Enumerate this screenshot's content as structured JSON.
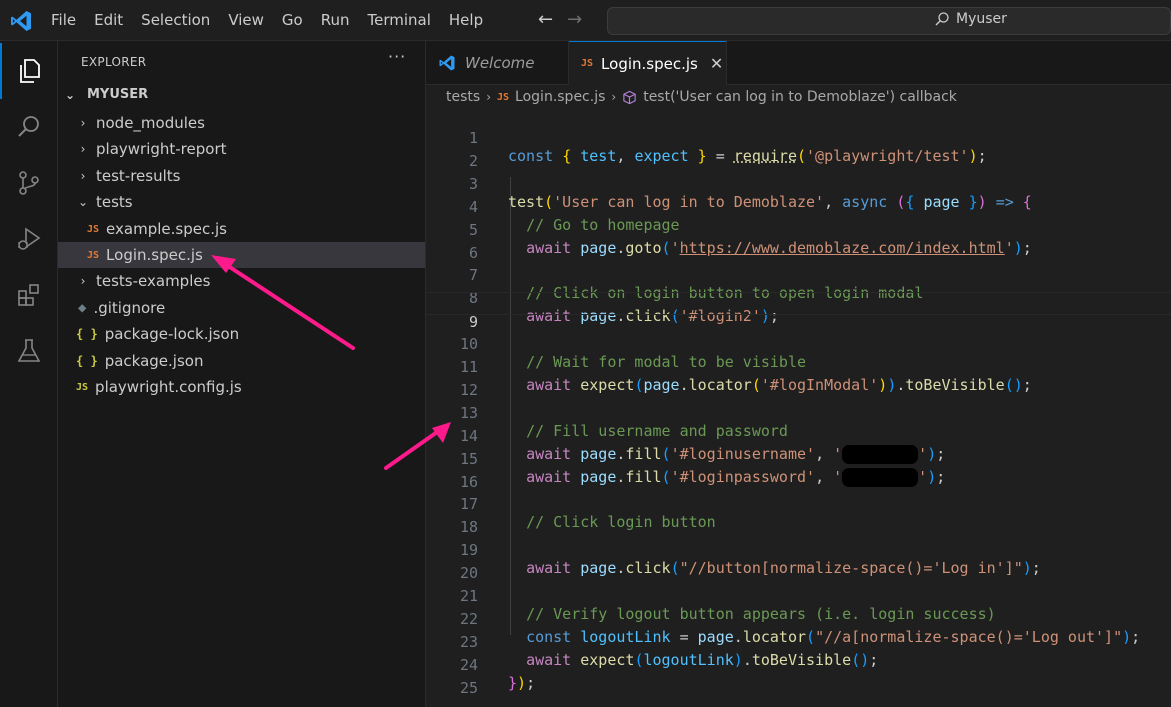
{
  "menu": [
    "File",
    "Edit",
    "Selection",
    "View",
    "Go",
    "Run",
    "Terminal",
    "Help"
  ],
  "search": {
    "text": "Myuser"
  },
  "sidebar": {
    "header": "EXPLORER",
    "root": "MYUSER",
    "items": [
      {
        "label": "node_modules"
      },
      {
        "label": "playwright-report"
      },
      {
        "label": "test-results"
      },
      {
        "label": "tests"
      },
      {
        "label": "example.spec.js",
        "icon": "JS"
      },
      {
        "label": "Login.spec.js",
        "icon": "JS"
      },
      {
        "label": "tests-examples"
      },
      {
        "label": ".gitignore"
      },
      {
        "label": "package-lock.json",
        "icon": "{ }"
      },
      {
        "label": "package.json",
        "icon": "{ }"
      },
      {
        "label": "playwright.config.js",
        "icon": "JS"
      }
    ]
  },
  "tabs": [
    {
      "label": "Welcome"
    },
    {
      "label": "Login.spec.js",
      "icon": "JS"
    }
  ],
  "breadcrumb": {
    "folder": "tests",
    "file": "Login.spec.js",
    "symbol": "test('User can log in to Demoblaze') callback"
  },
  "editor": {
    "line_numbers": [
      "1",
      "2",
      "3",
      "4",
      "5",
      "6",
      "7",
      "8",
      "9",
      "10",
      "11",
      "12",
      "13",
      "14",
      "15",
      "16",
      "17",
      "18",
      "19",
      "20",
      "21",
      "22",
      "23",
      "24",
      "25"
    ],
    "current_line": 9,
    "tokens": {
      "l1_const": "const",
      "l1_test": "test",
      "l1_expect": "expect",
      "l1_require": "require",
      "l1_mod": "'@playwright/test'",
      "l3_test": "test",
      "l3_title": "'User can log in to Demoblaze'",
      "l3_async": "async",
      "l3_page": "page",
      "l4_comment": "// Go to homepage",
      "l5_await": "await",
      "l5_page": "page",
      "l5_goto": "goto",
      "l5_q1": "'",
      "l5_url": "https://www.demoblaze.com/index.html",
      "l5_q2": "'",
      "l7_comment": "// Click on login button to open login modal",
      "l8_await": "await",
      "l8_page": "page",
      "l8_click": "click",
      "l8_sel": "'#login2'",
      "l10_comment": "// Wait for modal to be visible",
      "l11_await": "await",
      "l11_expect": "expect",
      "l11_page": "page",
      "l11_locator": "locator",
      "l11_sel": "'#logInModal'",
      "l11_vis": "toBeVisible",
      "l13_comment": "// Fill username and password",
      "l14_await": "await",
      "l14_page": "page",
      "l14_fill": "fill",
      "l14_sel": "'#loginusername'",
      "l14_q1": "'",
      "l14_q2": "'",
      "l15_await": "await",
      "l15_page": "page",
      "l15_fill": "fill",
      "l15_sel": "'#loginpassword'",
      "l15_q1": "'",
      "l15_q2": "'",
      "l17_comment": "// Click login button",
      "l19_await": "await",
      "l19_page": "page",
      "l19_click": "click",
      "l19_sel": "\"//button[normalize-space()='Log in']\"",
      "l21_comment": "// Verify logout button appears (i.e. login success)",
      "l22_const": "const",
      "l22_var": "logoutLink",
      "l22_page": "page",
      "l22_locator": "locator",
      "l22_sel": "\"//a[normalize-space()='Log out']\"",
      "l23_await": "await",
      "l23_expect": "expect",
      "l23_var": "logoutLink",
      "l23_vis": "toBeVisible"
    }
  },
  "colors": {
    "accent": "#0078d4",
    "annotation_arrow": "#ff1a8c",
    "js_icon": "#e37933"
  }
}
